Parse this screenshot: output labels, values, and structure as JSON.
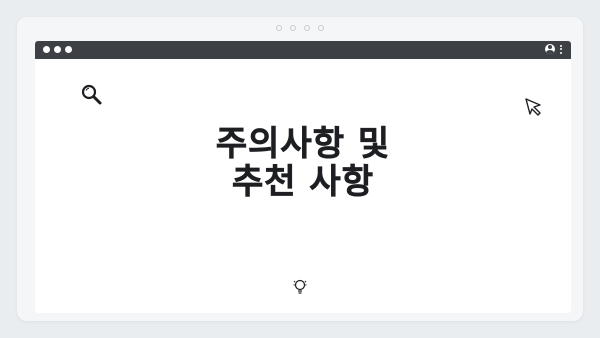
{
  "title_line1": "주의사항 및",
  "title_line2": "추천 사항",
  "icons": {
    "search": "search-icon",
    "cursor": "cursor-icon",
    "bulb": "lightbulb-icon",
    "avatar": "user-avatar-icon",
    "menu": "kebab-menu-icon"
  },
  "colors": {
    "background": "#e9edf0",
    "titlebar": "#3d4146",
    "text": "#1d1f22"
  }
}
